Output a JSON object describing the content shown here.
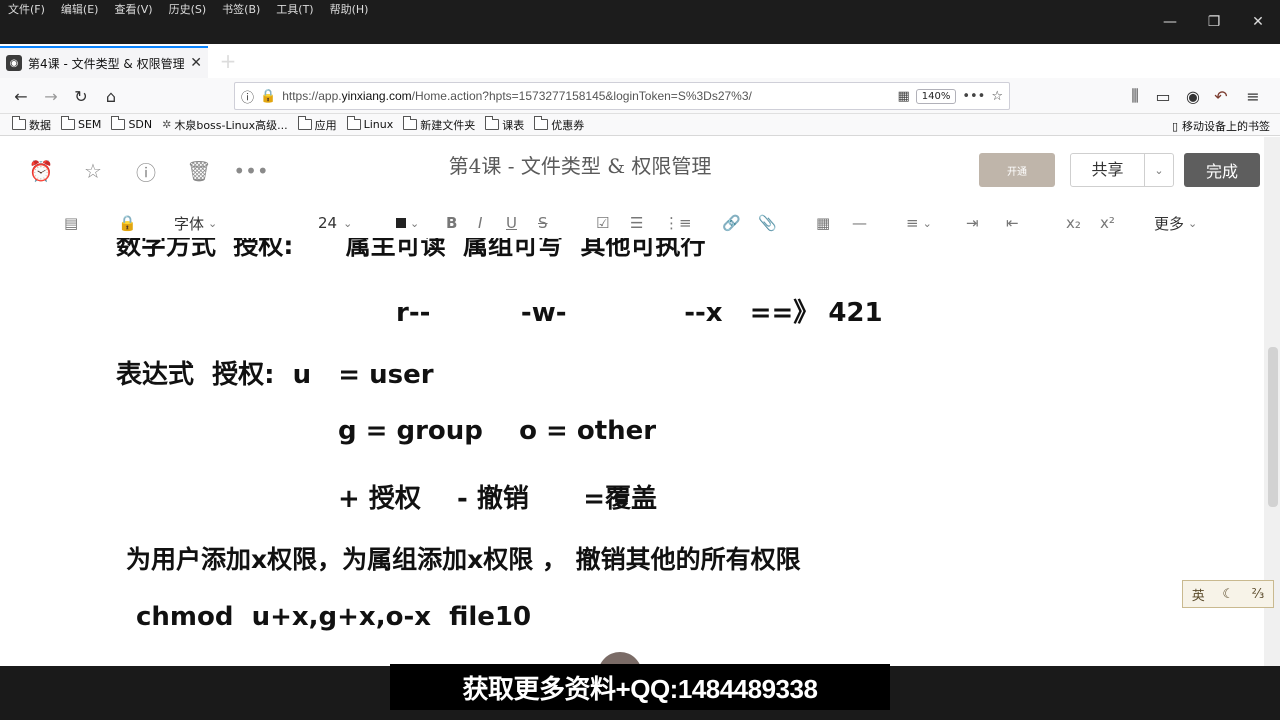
{
  "menubar": {
    "items": [
      "文件(F)",
      "编辑(E)",
      "查看(V)",
      "历史(S)",
      "书签(B)",
      "工具(T)",
      "帮助(H)"
    ]
  },
  "tab": {
    "title": "第4课 - 文件类型 & 权限管理",
    "close": "✕",
    "new": "+"
  },
  "window": {
    "minimize": "—",
    "restore": "❐",
    "close": "✕"
  },
  "nav": {
    "url_prefix": "https://app.",
    "url_domain": "yinxiang.com",
    "url_rest": "/Home.action?hpts=1573277158145&loginToken=S%3Ds27%3/",
    "zoom": "140%"
  },
  "bookmarks": {
    "items": [
      {
        "label": "数据",
        "icon": "folder"
      },
      {
        "label": "SEM",
        "icon": "folder"
      },
      {
        "label": "SDN",
        "icon": "folder"
      },
      {
        "label": "木泉boss-Linux高级...",
        "icon": "gear"
      },
      {
        "label": "应用",
        "icon": "folder"
      },
      {
        "label": "Linux",
        "icon": "folder"
      },
      {
        "label": "新建文件夹",
        "icon": "folder"
      },
      {
        "label": "课表",
        "icon": "folder"
      },
      {
        "label": "优惠券",
        "icon": "folder"
      }
    ],
    "mobile": "移动设备上的书签"
  },
  "editor": {
    "title": "第4课 - 文件类型 & 权限管理",
    "grey_button": "开通",
    "share": "共享",
    "done": "完成"
  },
  "toolbar": {
    "font": "字体",
    "size": "24",
    "more": "更多"
  },
  "content": {
    "line_partial": "数字方式  授权:      属主可读  属组可写  其他可执行",
    "line1": "r--          -w-             --x   ==》 421",
    "line2": "表达式  授权:  u   = user",
    "line3": "g = group    o = other",
    "line4": "+ 授权    - 撤销      =覆盖",
    "line5": "为用户添加x权限，为属组添加x权限 ， 撤销其他的所有权限",
    "line6": "chmod  u+x,g+x,o-x  file10"
  },
  "ime": {
    "a": "英",
    "b": "☾",
    "c": "⅔"
  },
  "banner": "获取更多资料+QQ:1484489338"
}
